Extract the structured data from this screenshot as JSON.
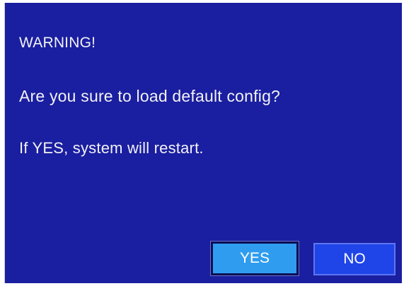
{
  "dialog": {
    "title": "WARNING!",
    "question": "Are you sure to load default config?",
    "note": "If YES, system will restart.",
    "buttons": {
      "yes_label": "YES",
      "no_label": "NO"
    },
    "selected_button": "YES"
  },
  "colors": {
    "dialog_background": "#1a1ea0",
    "text": "#f2f2f6",
    "yes_button_selected": "#2f9cf0",
    "no_button": "#1f45e8"
  }
}
